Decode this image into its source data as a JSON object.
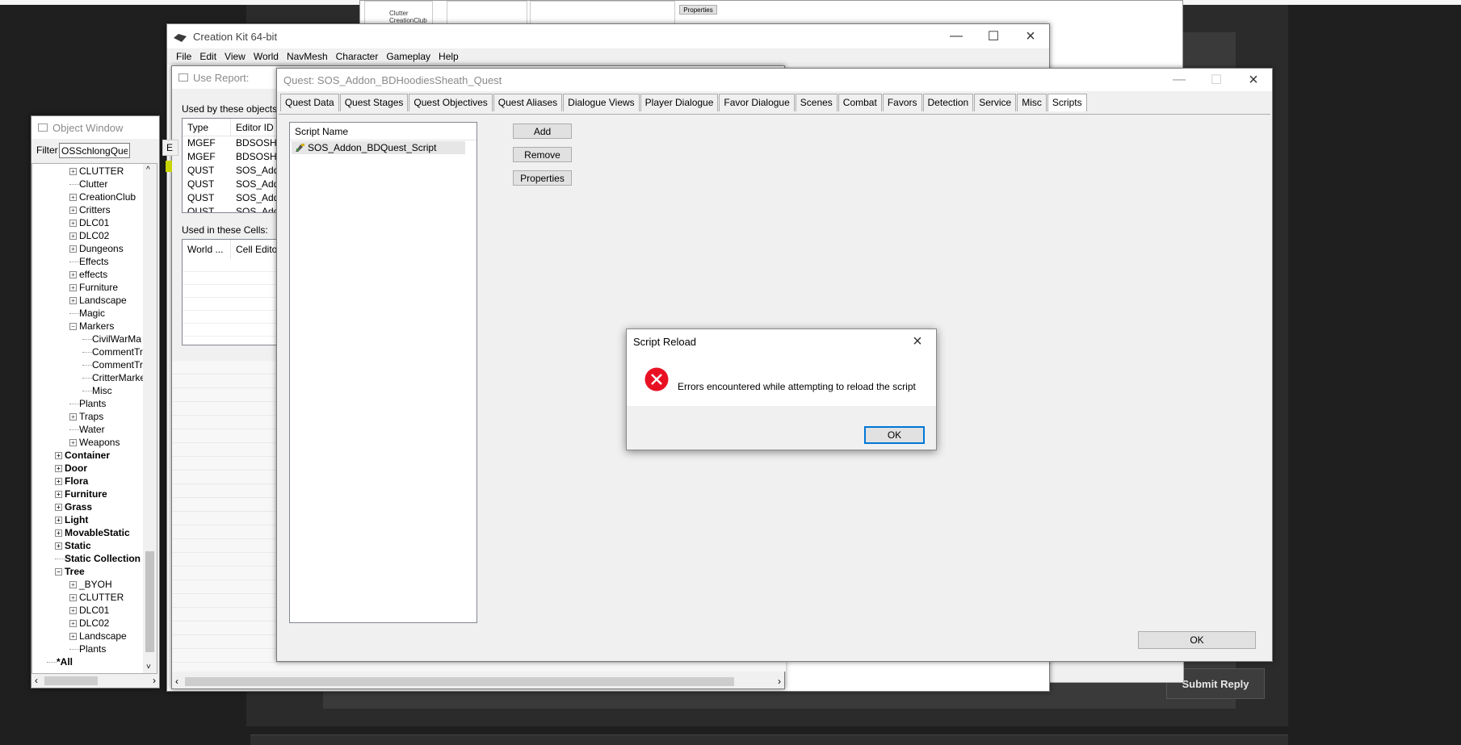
{
  "bg_forum": {
    "submit_label": "Submit Reply",
    "bg_tree": [
      "Clutter",
      "CreationClub"
    ],
    "bg_button": "Properties"
  },
  "ck": {
    "title": "Creation Kit 64-bit",
    "menu": [
      "File",
      "Edit",
      "View",
      "World",
      "NavMesh",
      "Character",
      "Gameplay",
      "Help"
    ]
  },
  "use_report": {
    "title": "Use Report:",
    "used_by_label": "Used by these objects:",
    "columns": [
      "Type",
      "Editor ID"
    ],
    "rows": [
      {
        "type": "MGEF",
        "id": "BDSOSHo"
      },
      {
        "type": "MGEF",
        "id": "BDSOSHo"
      },
      {
        "type": "QUST",
        "id": "SOS_Addo"
      },
      {
        "type": "QUST",
        "id": "SOS_Addo"
      },
      {
        "type": "QUST",
        "id": "SOS_Addo"
      },
      {
        "type": "QUST",
        "id": "SOS_Addo"
      }
    ],
    "cells_label": "Used in these Cells:",
    "cell_columns": [
      "World ...",
      "Cell Editor"
    ]
  },
  "object_window": {
    "title": "Object Window",
    "filter_label": "Filter",
    "filter_value": "OSSchlongQuest",
    "partial_header": "E",
    "tree": [
      {
        "label": "CLUTTER",
        "indent": 1,
        "exp": true,
        "bold": false
      },
      {
        "label": "Clutter",
        "indent": 1,
        "exp": false,
        "bold": false
      },
      {
        "label": "CreationClub",
        "indent": 1,
        "exp": true,
        "bold": false
      },
      {
        "label": "Critters",
        "indent": 1,
        "exp": true,
        "bold": false
      },
      {
        "label": "DLC01",
        "indent": 1,
        "exp": true,
        "bold": false
      },
      {
        "label": "DLC02",
        "indent": 1,
        "exp": true,
        "bold": false
      },
      {
        "label": "Dungeons",
        "indent": 1,
        "exp": true,
        "bold": false
      },
      {
        "label": "Effects",
        "indent": 1,
        "exp": false,
        "bold": false
      },
      {
        "label": "effects",
        "indent": 1,
        "exp": true,
        "bold": false
      },
      {
        "label": "Furniture",
        "indent": 1,
        "exp": true,
        "bold": false
      },
      {
        "label": "Landscape",
        "indent": 1,
        "exp": true,
        "bold": false
      },
      {
        "label": "Magic",
        "indent": 1,
        "exp": false,
        "bold": false
      },
      {
        "label": "Markers",
        "indent": 1,
        "exp": true,
        "bold": false,
        "open": true
      },
      {
        "label": "CivilWarMa",
        "indent": 2,
        "exp": false,
        "bold": false
      },
      {
        "label": "CommentTr",
        "indent": 2,
        "exp": false,
        "bold": false
      },
      {
        "label": "CommentTr",
        "indent": 2,
        "exp": false,
        "bold": false
      },
      {
        "label": "CritterMarke",
        "indent": 2,
        "exp": false,
        "bold": false
      },
      {
        "label": "Misc",
        "indent": 2,
        "exp": false,
        "bold": false
      },
      {
        "label": "Plants",
        "indent": 1,
        "exp": false,
        "bold": false
      },
      {
        "label": "Traps",
        "indent": 1,
        "exp": true,
        "bold": false
      },
      {
        "label": "Water",
        "indent": 1,
        "exp": false,
        "bold": false
      },
      {
        "label": "Weapons",
        "indent": 1,
        "exp": true,
        "bold": false
      },
      {
        "label": "Container",
        "indent": 0,
        "exp": true,
        "bold": true
      },
      {
        "label": "Door",
        "indent": 0,
        "exp": true,
        "bold": true
      },
      {
        "label": "Flora",
        "indent": 0,
        "exp": true,
        "bold": true
      },
      {
        "label": "Furniture",
        "indent": 0,
        "exp": true,
        "bold": true
      },
      {
        "label": "Grass",
        "indent": 0,
        "exp": true,
        "bold": true
      },
      {
        "label": "Light",
        "indent": 0,
        "exp": true,
        "bold": true
      },
      {
        "label": "MovableStatic",
        "indent": 0,
        "exp": true,
        "bold": true
      },
      {
        "label": "Static",
        "indent": 0,
        "exp": true,
        "bold": true
      },
      {
        "label": "Static Collection",
        "indent": 0,
        "exp": false,
        "bold": true
      },
      {
        "label": "Tree",
        "indent": 0,
        "exp": true,
        "bold": true,
        "open": true
      },
      {
        "label": "_BYOH",
        "indent": 1,
        "exp": true,
        "bold": false
      },
      {
        "label": "CLUTTER",
        "indent": 1,
        "exp": true,
        "bold": false
      },
      {
        "label": "DLC01",
        "indent": 1,
        "exp": true,
        "bold": false
      },
      {
        "label": "DLC02",
        "indent": 1,
        "exp": true,
        "bold": false
      },
      {
        "label": "Landscape",
        "indent": 1,
        "exp": true,
        "bold": false
      },
      {
        "label": "Plants",
        "indent": 1,
        "exp": false,
        "bold": false
      },
      {
        "label": "*All",
        "indent": -1,
        "exp": false,
        "bold": true
      }
    ]
  },
  "quest": {
    "title": "Quest: SOS_Addon_BDHoodiesSheath_Quest",
    "tabs": [
      "Quest Data",
      "Quest Stages",
      "Quest Objectives",
      "Quest Aliases",
      "Dialogue Views",
      "Player Dialogue",
      "Favor Dialogue",
      "Scenes",
      "Combat",
      "Favors",
      "Detection",
      "Service",
      "Misc",
      "Scripts"
    ],
    "active_tab": "Scripts",
    "script_header": "Script Name",
    "scripts": [
      "SOS_Addon_BDQuest_Script"
    ],
    "add_label": "Add",
    "remove_label": "Remove",
    "properties_label": "Properties",
    "ok_label": "OK"
  },
  "dialog": {
    "title": "Script Reload",
    "message": "Errors encountered while attempting to reload the script",
    "ok_label": "OK"
  },
  "colors": {
    "error_red": "#e81123",
    "focus_blue": "#0078d7",
    "selection_grey": "#e6e6e6"
  }
}
